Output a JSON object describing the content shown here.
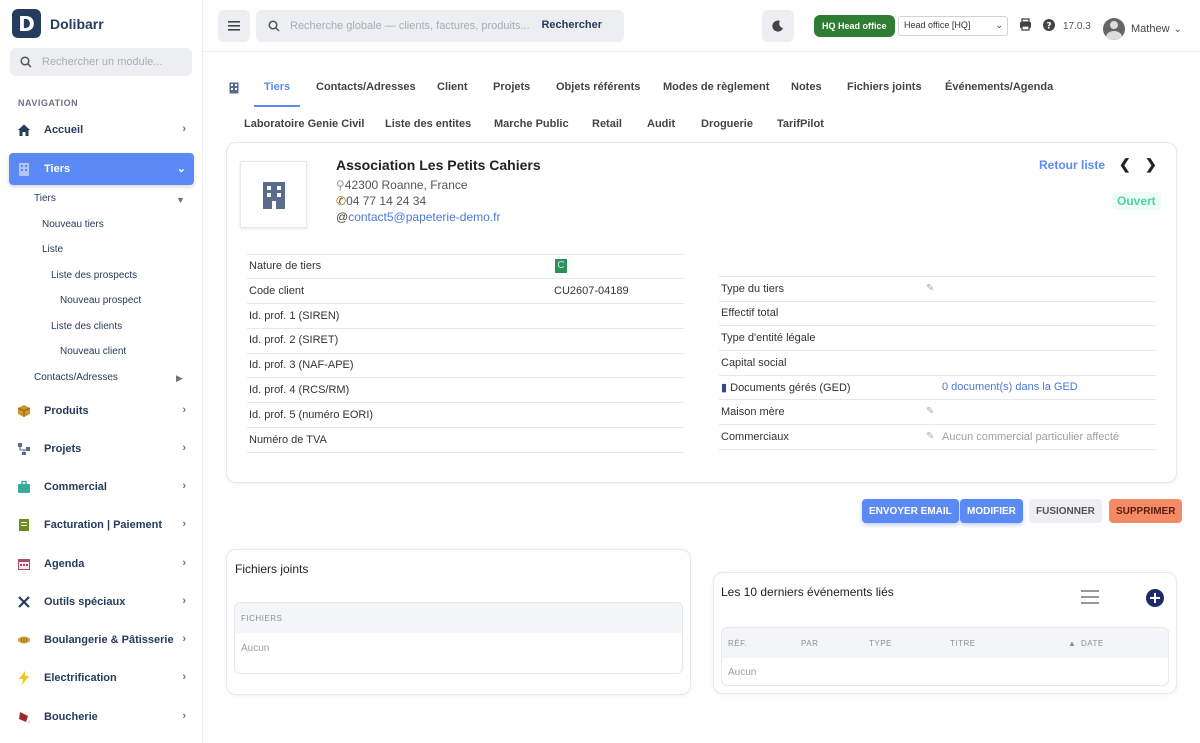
{
  "brand": {
    "logo_letter": "D",
    "name": "Dolibarr"
  },
  "sidebar": {
    "search_placeholder": "Rechercher un module...",
    "nav_heading": "NAVIGATION",
    "items": [
      {
        "label": "Accueil",
        "icon": "home-icon"
      },
      {
        "label": "Tiers",
        "icon": "building-icon"
      },
      {
        "label": "Produits",
        "icon": "box-icon"
      },
      {
        "label": "Projets",
        "icon": "project-icon"
      },
      {
        "label": "Commercial",
        "icon": "briefcase-icon"
      },
      {
        "label": "Facturation | Paiement",
        "icon": "invoice-icon"
      },
      {
        "label": "Agenda",
        "icon": "calendar-icon"
      },
      {
        "label": "Outils spéciaux",
        "icon": "tools-icon"
      },
      {
        "label": "Boulangerie & Pâtisserie",
        "icon": "bread-icon"
      },
      {
        "label": "Electrification",
        "icon": "bolt-icon"
      },
      {
        "label": "Boucherie",
        "icon": "meat-icon"
      }
    ],
    "tiers_sub": {
      "tiers": "Tiers",
      "nouveau_tiers": "Nouveau tiers",
      "liste": "Liste",
      "liste_prospects": "Liste des prospects",
      "nouveau_prospect": "Nouveau prospect",
      "liste_clients": "Liste des clients",
      "nouveau_client": "Nouveau client",
      "contacts": "Contacts/Adresses"
    }
  },
  "topbar": {
    "search_placeholder": "Recherche globale — clients, factures, produits...",
    "search_button": "Rechercher",
    "hq_badge": "HQ Head office",
    "entity_selected": "Head office [HQ]",
    "version": "17.0.3",
    "user_name": "Mathew"
  },
  "tabs": {
    "row1": [
      "Tiers",
      "Contacts/Adresses",
      "Client",
      "Projets",
      "Objets référents",
      "Modes de règlement",
      "Notes",
      "Fichiers joints",
      "Événements/Agenda"
    ],
    "row2": [
      "Laboratoire Genie Civil",
      "Liste des entites",
      "Marche Public",
      "Retail",
      "Audit",
      "Droguerie",
      "TarifPilot"
    ]
  },
  "company": {
    "name": "Association Les Petits Cahiers",
    "address": "42300 Roanne, France",
    "phone": "04 77 14 24 34",
    "email": "contact5@papeterie-demo.fr",
    "back_link": "Retour liste",
    "status": "Ouvert"
  },
  "fields_left": [
    {
      "label": "Nature de tiers",
      "value": "C"
    },
    {
      "label": "Code client",
      "value": "CU2607-04189"
    },
    {
      "label": "Id. prof. 1 (SIREN)",
      "value": ""
    },
    {
      "label": "Id. prof. 2 (SIRET)",
      "value": ""
    },
    {
      "label": "Id. prof. 3 (NAF-APE)",
      "value": ""
    },
    {
      "label": "Id. prof. 4 (RCS/RM)",
      "value": ""
    },
    {
      "label": "Id. prof. 5 (numéro EORI)",
      "value": ""
    },
    {
      "label": "Numéro de TVA",
      "value": ""
    }
  ],
  "fields_right": [
    {
      "label": "Type du tiers",
      "value": ""
    },
    {
      "label": "Effectif total",
      "value": ""
    },
    {
      "label": "Type d'entité légale",
      "value": ""
    },
    {
      "label": "Capital social",
      "value": ""
    },
    {
      "label": "Documents gérés (GED)",
      "value": "0 document(s) dans la GED"
    },
    {
      "label": "Maison mère",
      "value": ""
    },
    {
      "label": "Commerciaux",
      "value": "Aucun commercial particulier affecté"
    }
  ],
  "actions": {
    "email": "ENVOYER EMAIL",
    "modify": "MODIFIER",
    "merge": "FUSIONNER",
    "delete": "SUPPRIMER"
  },
  "files_section": {
    "title": "Fichiers joints",
    "column": "FICHIERS",
    "empty": "Aucun"
  },
  "events_section": {
    "title": "Les 10 derniers événements liés",
    "columns": [
      "RÉF.",
      "PAR",
      "TYPE",
      "TITRE",
      "DATE"
    ],
    "empty": "Aucun"
  },
  "colors": {
    "accent": "#5b8af5",
    "brand": "#263c5c",
    "status_open": "#4cd3a3",
    "hq_green": "#2f7d32",
    "delete": "#f58a67"
  }
}
